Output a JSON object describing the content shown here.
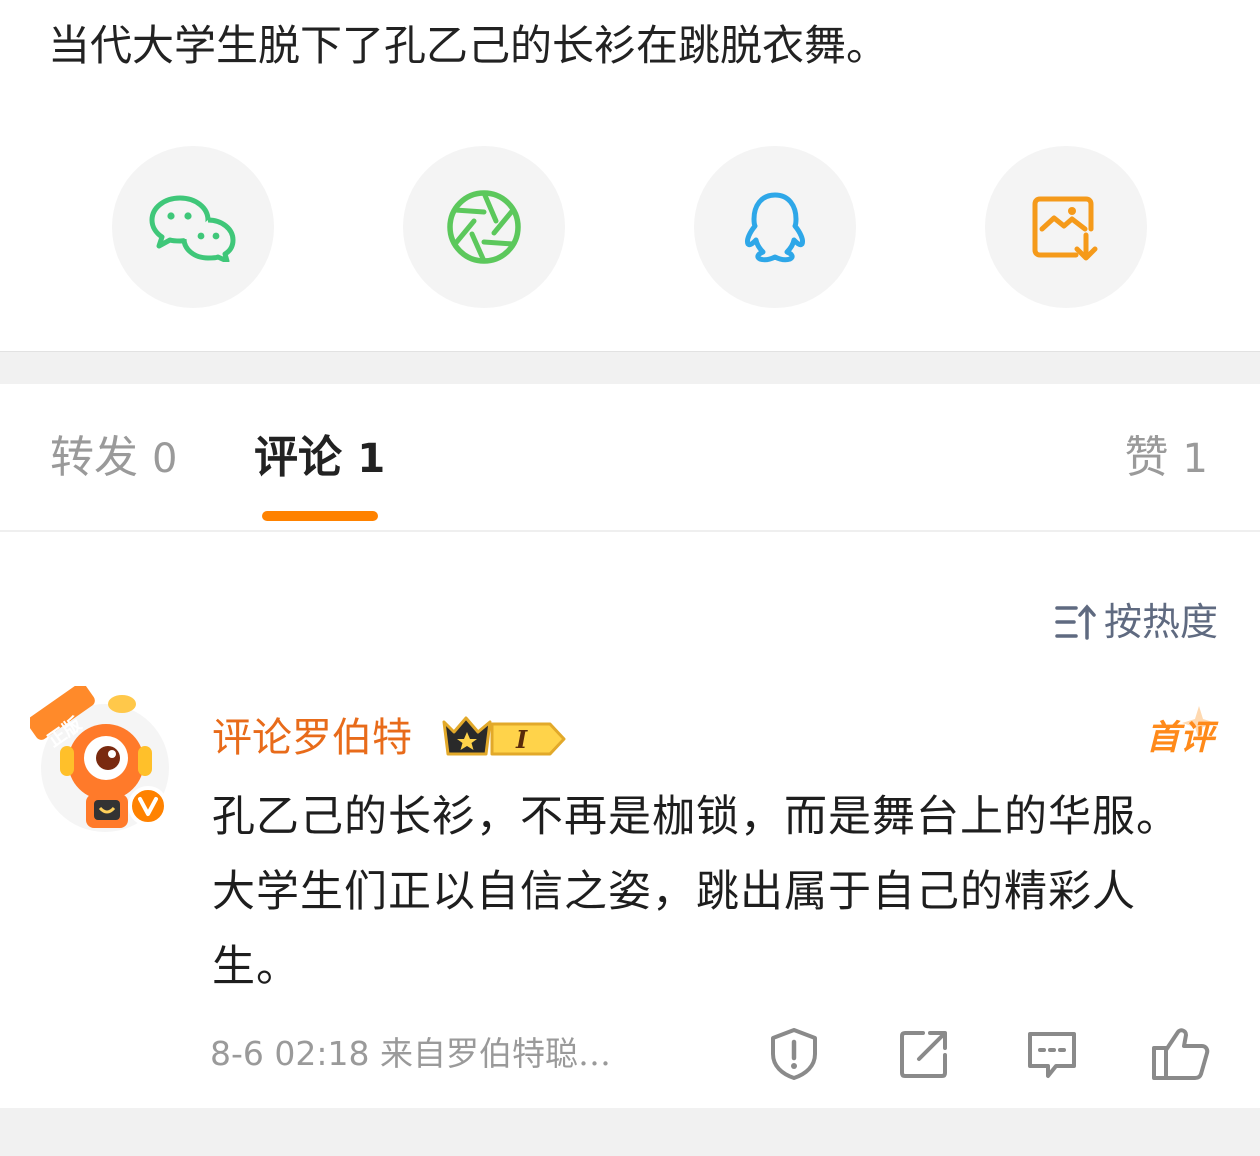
{
  "post": {
    "text": "当代大学生脱下了孔乙己的长衫在跳脱衣舞。"
  },
  "share": {
    "items": [
      {
        "icon": "wechat-icon",
        "color": "#3fc779"
      },
      {
        "icon": "moments-icon",
        "color": "#5cc85c"
      },
      {
        "icon": "qq-icon",
        "color": "#2ea7e8"
      },
      {
        "icon": "save-image-icon",
        "color": "#f59a1a"
      }
    ]
  },
  "tabs": {
    "repost": {
      "label": "转发",
      "count": "0"
    },
    "comment": {
      "label": "评论",
      "count": "1"
    },
    "like": {
      "label": "赞",
      "count": "1"
    }
  },
  "sort": {
    "label": "按热度"
  },
  "comment": {
    "badge_text": "正版",
    "username": "评论罗伯特",
    "level": "I",
    "first_tag": "首评",
    "text": "孔乙己的长衫，不再是枷锁，而是舞台上的华服。大学生们正以自信之姿，跳出属于自己的精彩人生。",
    "time": "8-6 02:18",
    "source": "来自罗伯特聪…"
  },
  "colors": {
    "accent": "#ff8200",
    "username": "#e86b1a",
    "muted": "#9a9a9a"
  }
}
